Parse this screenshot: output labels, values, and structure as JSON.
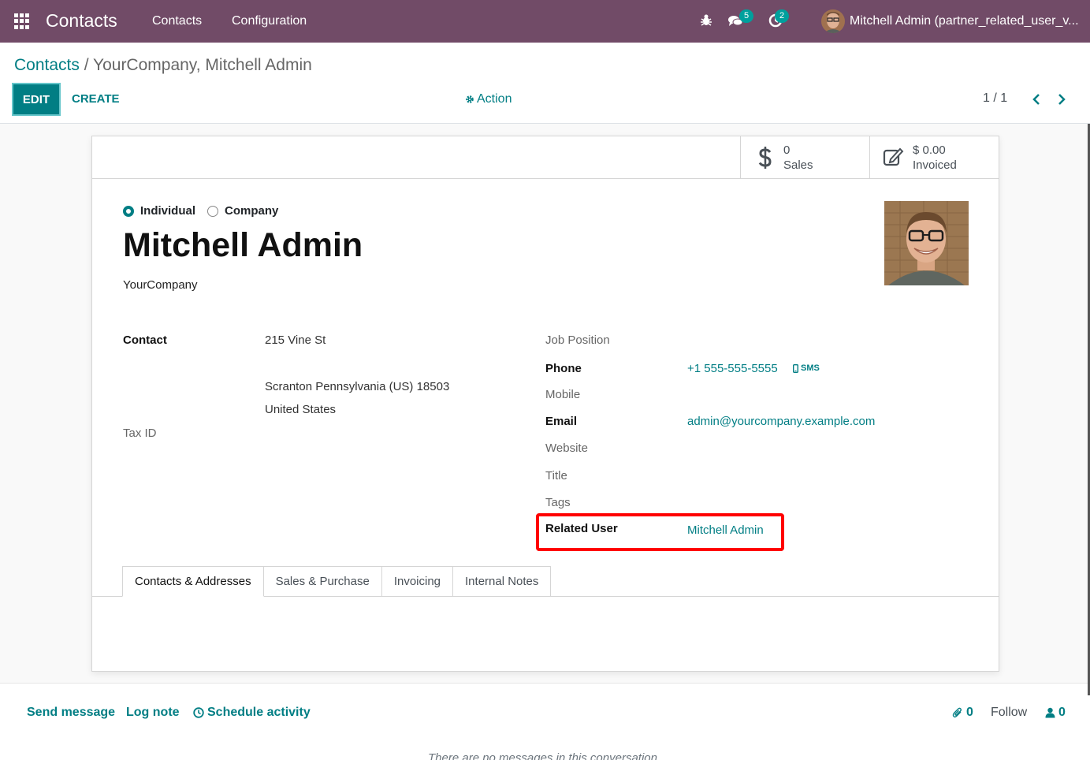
{
  "navbar": {
    "app_title": "Contacts",
    "menu": [
      "Contacts",
      "Configuration"
    ],
    "messages_count": "5",
    "activities_count": "2",
    "user_name": "Mitchell Admin (partner_related_user_v..."
  },
  "breadcrumb": {
    "parent": "Contacts",
    "separator": " / ",
    "current": "YourCompany, Mitchell Admin"
  },
  "toolbar": {
    "edit_label": "EDIT",
    "create_label": "CREATE",
    "action_label": "Action",
    "pager_value": "1 / 1"
  },
  "stat_buttons": {
    "sales": {
      "value": "0",
      "label": "Sales"
    },
    "invoiced": {
      "value": "$ 0.00",
      "label": "Invoiced"
    }
  },
  "form": {
    "type_individual": "Individual",
    "type_company": "Company",
    "name": "Mitchell Admin",
    "company": "YourCompany",
    "left": {
      "contact_label": "Contact",
      "street": "215 Vine St",
      "city_line": "Scranton  Pennsylvania (US)  18503",
      "country": "United States",
      "tax_id_label": "Tax ID"
    },
    "right": {
      "job_position_label": "Job Position",
      "phone_label": "Phone",
      "phone_value": "+1 555-555-5555",
      "sms_label": "SMS",
      "mobile_label": "Mobile",
      "email_label": "Email",
      "email_value": "admin@yourcompany.example.com",
      "website_label": "Website",
      "title_label": "Title",
      "tags_label": "Tags",
      "related_user_label": "Related User",
      "related_user_value": "Mitchell Admin"
    },
    "tabs": [
      "Contacts & Addresses",
      "Sales & Purchase",
      "Invoicing",
      "Internal Notes"
    ]
  },
  "chatter": {
    "send_message": "Send message",
    "log_note": "Log note",
    "schedule_activity": "Schedule activity",
    "attachments_count": "0",
    "follow_label": "Follow",
    "followers_count": "0",
    "empty_message": "There are no messages in this conversation."
  },
  "colors": {
    "navbar": "#714b67",
    "accent": "#017e84",
    "highlight": "#ff0000"
  }
}
